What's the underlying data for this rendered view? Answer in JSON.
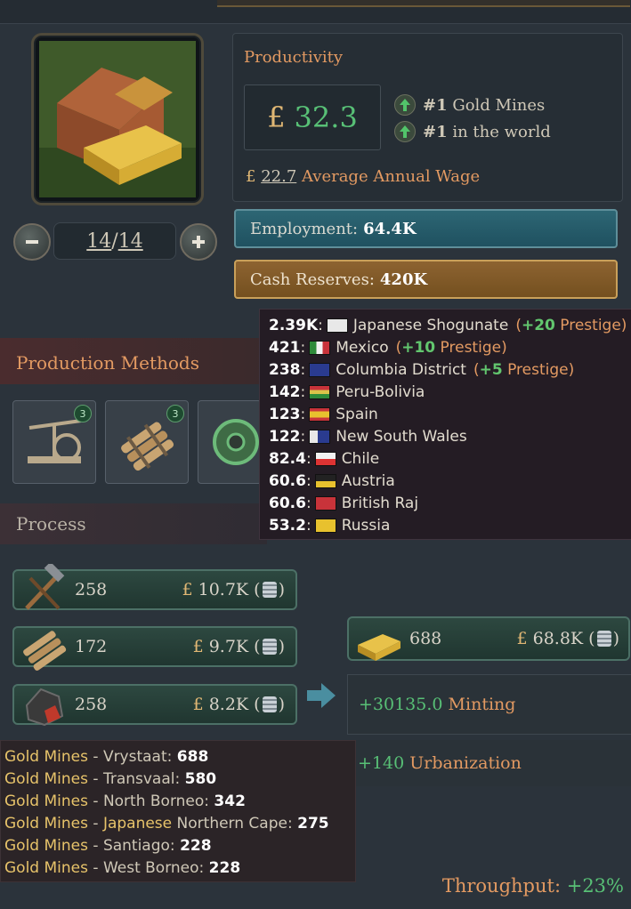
{
  "building": {
    "icon": "gold-mine-building-icon",
    "level_current": "14",
    "level_max": "14"
  },
  "productivity": {
    "title": "Productivity",
    "currency": "£",
    "value": "32.3",
    "ranks": [
      {
        "rank": "#1",
        "label": "Gold Mines"
      },
      {
        "rank": "#1",
        "label": "in the world"
      }
    ],
    "wage_value": "22.7",
    "wage_label": "Average Annual Wage"
  },
  "employment": {
    "label": "Employment:",
    "value": "64.4K"
  },
  "cash_reserves": {
    "label": "Cash Reserves:",
    "value": "420K"
  },
  "production_methods": {
    "title": "Production Methods",
    "tiles": [
      {
        "icon": "pump-icon",
        "badge": "3"
      },
      {
        "icon": "dynamite-icon",
        "badge": "3"
      },
      {
        "icon": "automation-gear-icon",
        "badge": ""
      }
    ]
  },
  "process": {
    "title": "Process"
  },
  "country_tooltip": [
    {
      "value": "2.39K",
      "country": "Japanese Shogunate",
      "bonus_num": "+20",
      "bonus_label": "Prestige",
      "flag": "#e8e8e8"
    },
    {
      "value": "421",
      "country": "Mexico",
      "bonus_num": "+10",
      "bonus_label": "Prestige",
      "flag": "#2e8b3a"
    },
    {
      "value": "238",
      "country": "Columbia District",
      "bonus_num": "+5",
      "bonus_label": "Prestige",
      "flag": "#2a3b8f"
    },
    {
      "value": "142",
      "country": "Peru-Bolivia",
      "bonus_num": "",
      "bonus_label": "",
      "flag": "#c8333a"
    },
    {
      "value": "123",
      "country": "Spain",
      "bonus_num": "",
      "bonus_label": "",
      "flag": "#d9a21f"
    },
    {
      "value": "122",
      "country": "New South Wales",
      "bonus_num": "",
      "bonus_label": "",
      "flag": "#2a3b8f"
    },
    {
      "value": "82.4",
      "country": "Chile",
      "bonus_num": "",
      "bonus_label": "",
      "flag": "#d33"
    },
    {
      "value": "60.6",
      "country": "Austria",
      "bonus_num": "",
      "bonus_label": "",
      "flag": "#e8c12e"
    },
    {
      "value": "60.6",
      "country": "British Raj",
      "bonus_num": "",
      "bonus_label": "",
      "flag": "#c8333a"
    },
    {
      "value": "53.2",
      "country": "Russia",
      "bonus_num": "",
      "bonus_label": "",
      "flag": "#e8c12e"
    }
  ],
  "inputs": [
    {
      "icon": "tools-icon",
      "qty": "258",
      "currency": "£",
      "price": "10.7K"
    },
    {
      "icon": "explosives-icon",
      "qty": "172",
      "currency": "£",
      "price": "9.7K"
    },
    {
      "icon": "coal-icon",
      "qty": "258",
      "currency": "£",
      "price": "8.2K"
    }
  ],
  "output": {
    "icon": "gold-bar-icon",
    "qty": "688",
    "currency": "£",
    "price": "68.8K"
  },
  "minting": {
    "value": "+30135.0",
    "label": "Minting"
  },
  "urbanization": {
    "value": "+140",
    "label": "Urbanization"
  },
  "mines_tooltip": [
    {
      "owner": "Gold Mines",
      "owner2": "",
      "region": "Vrystaat",
      "value": "688"
    },
    {
      "owner": "Gold Mines",
      "owner2": "",
      "region": "Transvaal",
      "value": "580"
    },
    {
      "owner": "Gold Mines",
      "owner2": "",
      "region": "North Borneo",
      "value": "342"
    },
    {
      "owner": "Gold Mines",
      "owner2": "Japanese",
      "region": "Northern Cape",
      "value": "275"
    },
    {
      "owner": "Gold Mines",
      "owner2": "",
      "region": "Santiago",
      "value": "228"
    },
    {
      "owner": "Gold Mines",
      "owner2": "",
      "region": "West Borneo",
      "value": "228"
    }
  ],
  "throughput": {
    "label": "Throughput:",
    "value": "+23%"
  }
}
